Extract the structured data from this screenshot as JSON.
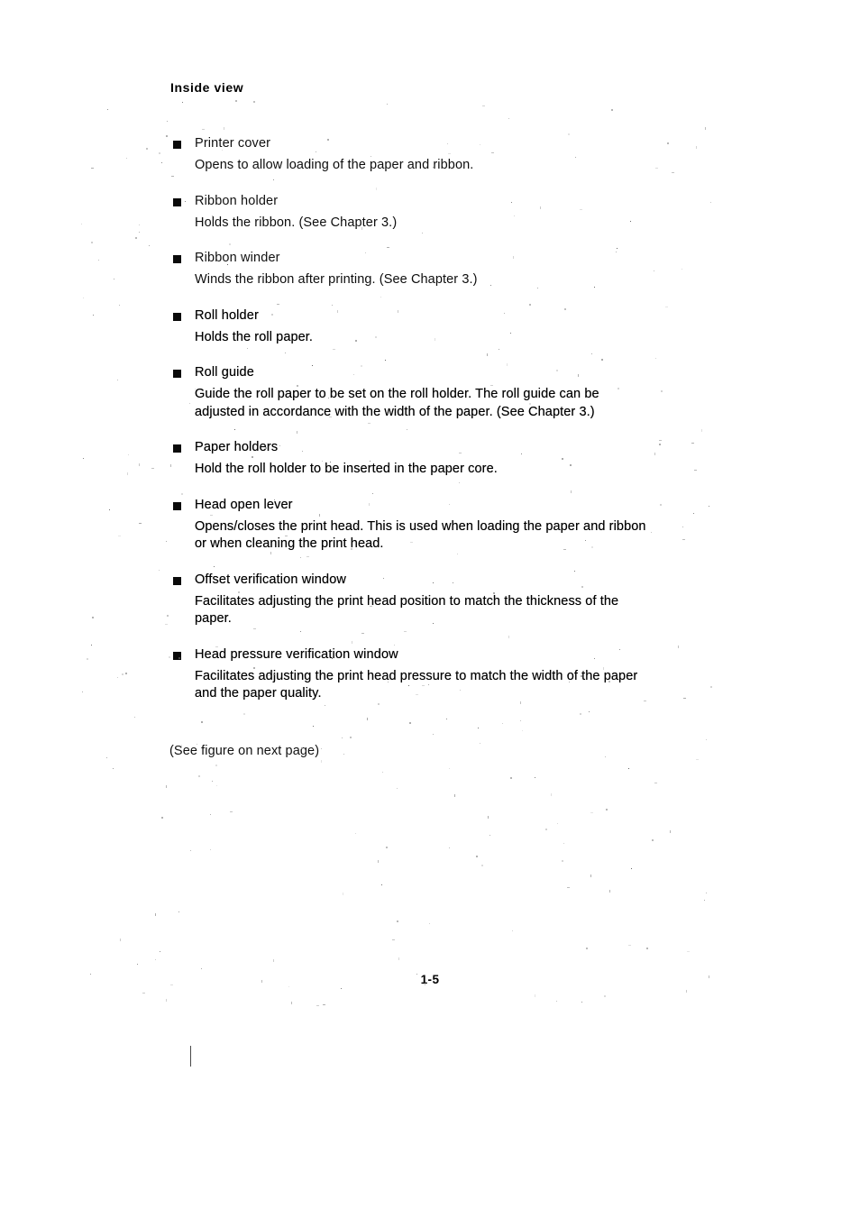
{
  "page": {
    "heading": "Inside view",
    "figure_note": "(See figure on next page)",
    "page_number": "1-5",
    "bullet_glyph": "filled-square"
  },
  "items": [
    {
      "label": "Printer cover",
      "description": "Opens to allow loading of the paper and ribbon."
    },
    {
      "label": "Ribbon holder",
      "description": "Holds the ribbon.  (See Chapter 3.)"
    },
    {
      "label": "Ribbon winder",
      "description": "Winds the ribbon after printing.  (See Chapter 3.)"
    },
    {
      "label": "Roll holder",
      "description": "Holds the roll paper."
    },
    {
      "label": "Roll guide",
      "description": "Guide the roll paper to be set on the roll holder.  The roll guide can be adjusted in accordance with the width of the paper.  (See Chapter 3.)"
    },
    {
      "label": "Paper holders",
      "description": "Hold the roll holder to be inserted in the paper core."
    },
    {
      "label": "Head open lever",
      "description": "Opens/closes the print head.  This is used when loading the paper and ribbon or when cleaning the print head."
    },
    {
      "label": "Offset verification window",
      "description": "Facilitates adjusting the print head position to match the thickness of the paper."
    },
    {
      "label": "Head pressure verification window",
      "description": "Facilitates adjusting the print head pressure to match the width of the paper and the paper quality."
    }
  ]
}
